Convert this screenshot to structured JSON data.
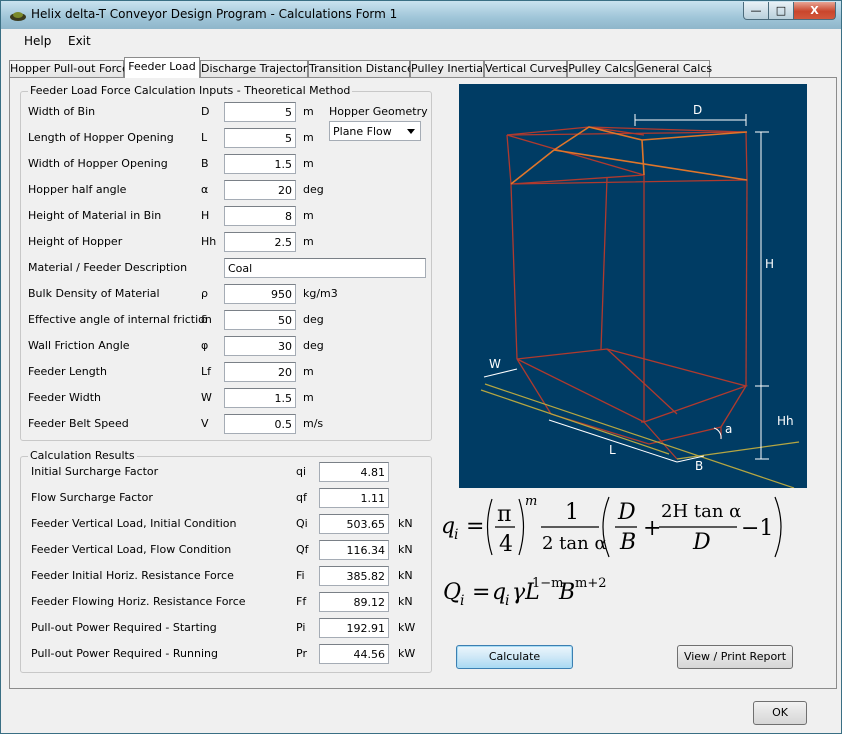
{
  "window": {
    "title": "Helix delta-T Conveyor Design Program - Calculations Form 1",
    "buttons": {
      "minimize": "—",
      "maximize": "□",
      "close": "X"
    }
  },
  "menu": {
    "help": "Help",
    "exit": "Exit"
  },
  "tabs": [
    {
      "label": "Hopper Pull-out Force"
    },
    {
      "label": "Feeder Load"
    },
    {
      "label": "Discharge Trajectory"
    },
    {
      "label": "Transition Distance"
    },
    {
      "label": "Pulley Inertia"
    },
    {
      "label": "Vertical Curves"
    },
    {
      "label": "Pulley Calcs"
    },
    {
      "label": "General Calcs"
    }
  ],
  "active_tab": "Feeder Load",
  "inputs_group": {
    "title": "Feeder Load Force Calculation Inputs - Theoretical Method",
    "rows": [
      {
        "label": "Width of Bin",
        "symbol": "D",
        "value": "5",
        "unit": "m"
      },
      {
        "label": "Length of Hopper Opening",
        "symbol": "L",
        "value": "5",
        "unit": "m"
      },
      {
        "label": "Width of Hopper Opening",
        "symbol": "B",
        "value": "1.5",
        "unit": "m"
      },
      {
        "label": "Hopper half angle",
        "symbol": "α",
        "value": "20",
        "unit": "deg"
      },
      {
        "label": "Height of Material in Bin",
        "symbol": "H",
        "value": "8",
        "unit": "m"
      },
      {
        "label": "Height of Hopper",
        "symbol": "Hh",
        "value": "2.5",
        "unit": "m"
      },
      {
        "label": "Material / Feeder Description",
        "symbol": "",
        "value": "Coal",
        "unit": ""
      },
      {
        "label": "Bulk Density of Material",
        "symbol": "ρ",
        "value": "950",
        "unit": "kg/m3"
      },
      {
        "label": "Effective angle of internal friction",
        "symbol": "δ",
        "value": "50",
        "unit": "deg"
      },
      {
        "label": "Wall Friction Angle",
        "symbol": "φ",
        "value": "30",
        "unit": "deg"
      },
      {
        "label": "Feeder Length",
        "symbol": "Lf",
        "value": "20",
        "unit": "m"
      },
      {
        "label": "Feeder Width",
        "symbol": "W",
        "value": "1.5",
        "unit": "m"
      },
      {
        "label": "Feeder Belt Speed",
        "symbol": "V",
        "value": "0.5",
        "unit": "m/s"
      }
    ],
    "geometry_label": "Hopper Geometry",
    "geometry_value": "Plane Flow"
  },
  "results_group": {
    "title": "Calculation Results",
    "rows": [
      {
        "label": "Initial Surcharge Factor",
        "symbol": "qi",
        "value": "4.81",
        "unit": ""
      },
      {
        "label": "Flow Surcharge Factor",
        "symbol": "qf",
        "value": "1.11",
        "unit": ""
      },
      {
        "label": "Feeder Vertical Load, Initial Condition",
        "symbol": "Qi",
        "value": "503.65",
        "unit": "kN"
      },
      {
        "label": "Feeder Vertical Load, Flow Condition",
        "symbol": "Qf",
        "value": "116.34",
        "unit": "kN"
      },
      {
        "label": "Feeder Initial Horiz. Resistance Force",
        "symbol": "Fi",
        "value": "385.82",
        "unit": "kN"
      },
      {
        "label": "Feeder Flowing Horiz. Resistance Force",
        "symbol": "Ff",
        "value": "89.12",
        "unit": "kN"
      },
      {
        "label": "Pull-out Power Required - Starting",
        "symbol": "Pi",
        "value": "192.91",
        "unit": "kW"
      },
      {
        "label": "Pull-out Power Required - Running",
        "symbol": "Pr",
        "value": "44.56",
        "unit": "kW"
      }
    ]
  },
  "diagram": {
    "labels": {
      "d": "D",
      "h": "H",
      "hh": "Hh",
      "w": "W",
      "l": "L",
      "b": "B",
      "a": "a"
    },
    "colors": {
      "background": "#003c64",
      "bin": "#b03a2e",
      "hopper_top": "#e0762a",
      "dims": "#ffffff",
      "belt": "#b5a642"
    }
  },
  "formula1": {
    "lhs": "q",
    "lhs_sub": "i",
    "eq": "=",
    "pi": "π",
    "four": "4",
    "exp_m": "m",
    "one": "1",
    "two_tan_alpha": "2 tan α",
    "d": "D",
    "b": "B",
    "plus": "+",
    "two_h_tan": "2H tan α",
    "d2": "D",
    "minus_one": "−1"
  },
  "formula2": {
    "lhs": "Q",
    "lhs_sub": "i",
    "eq": "=",
    "q": "q",
    "q_sub": "i",
    "gamma_l": "γL",
    "exp1": "1−m",
    "b": "B",
    "exp2": "m+2"
  },
  "buttons": {
    "calculate": "Calculate",
    "report": "View / Print Report",
    "ok": "OK"
  }
}
